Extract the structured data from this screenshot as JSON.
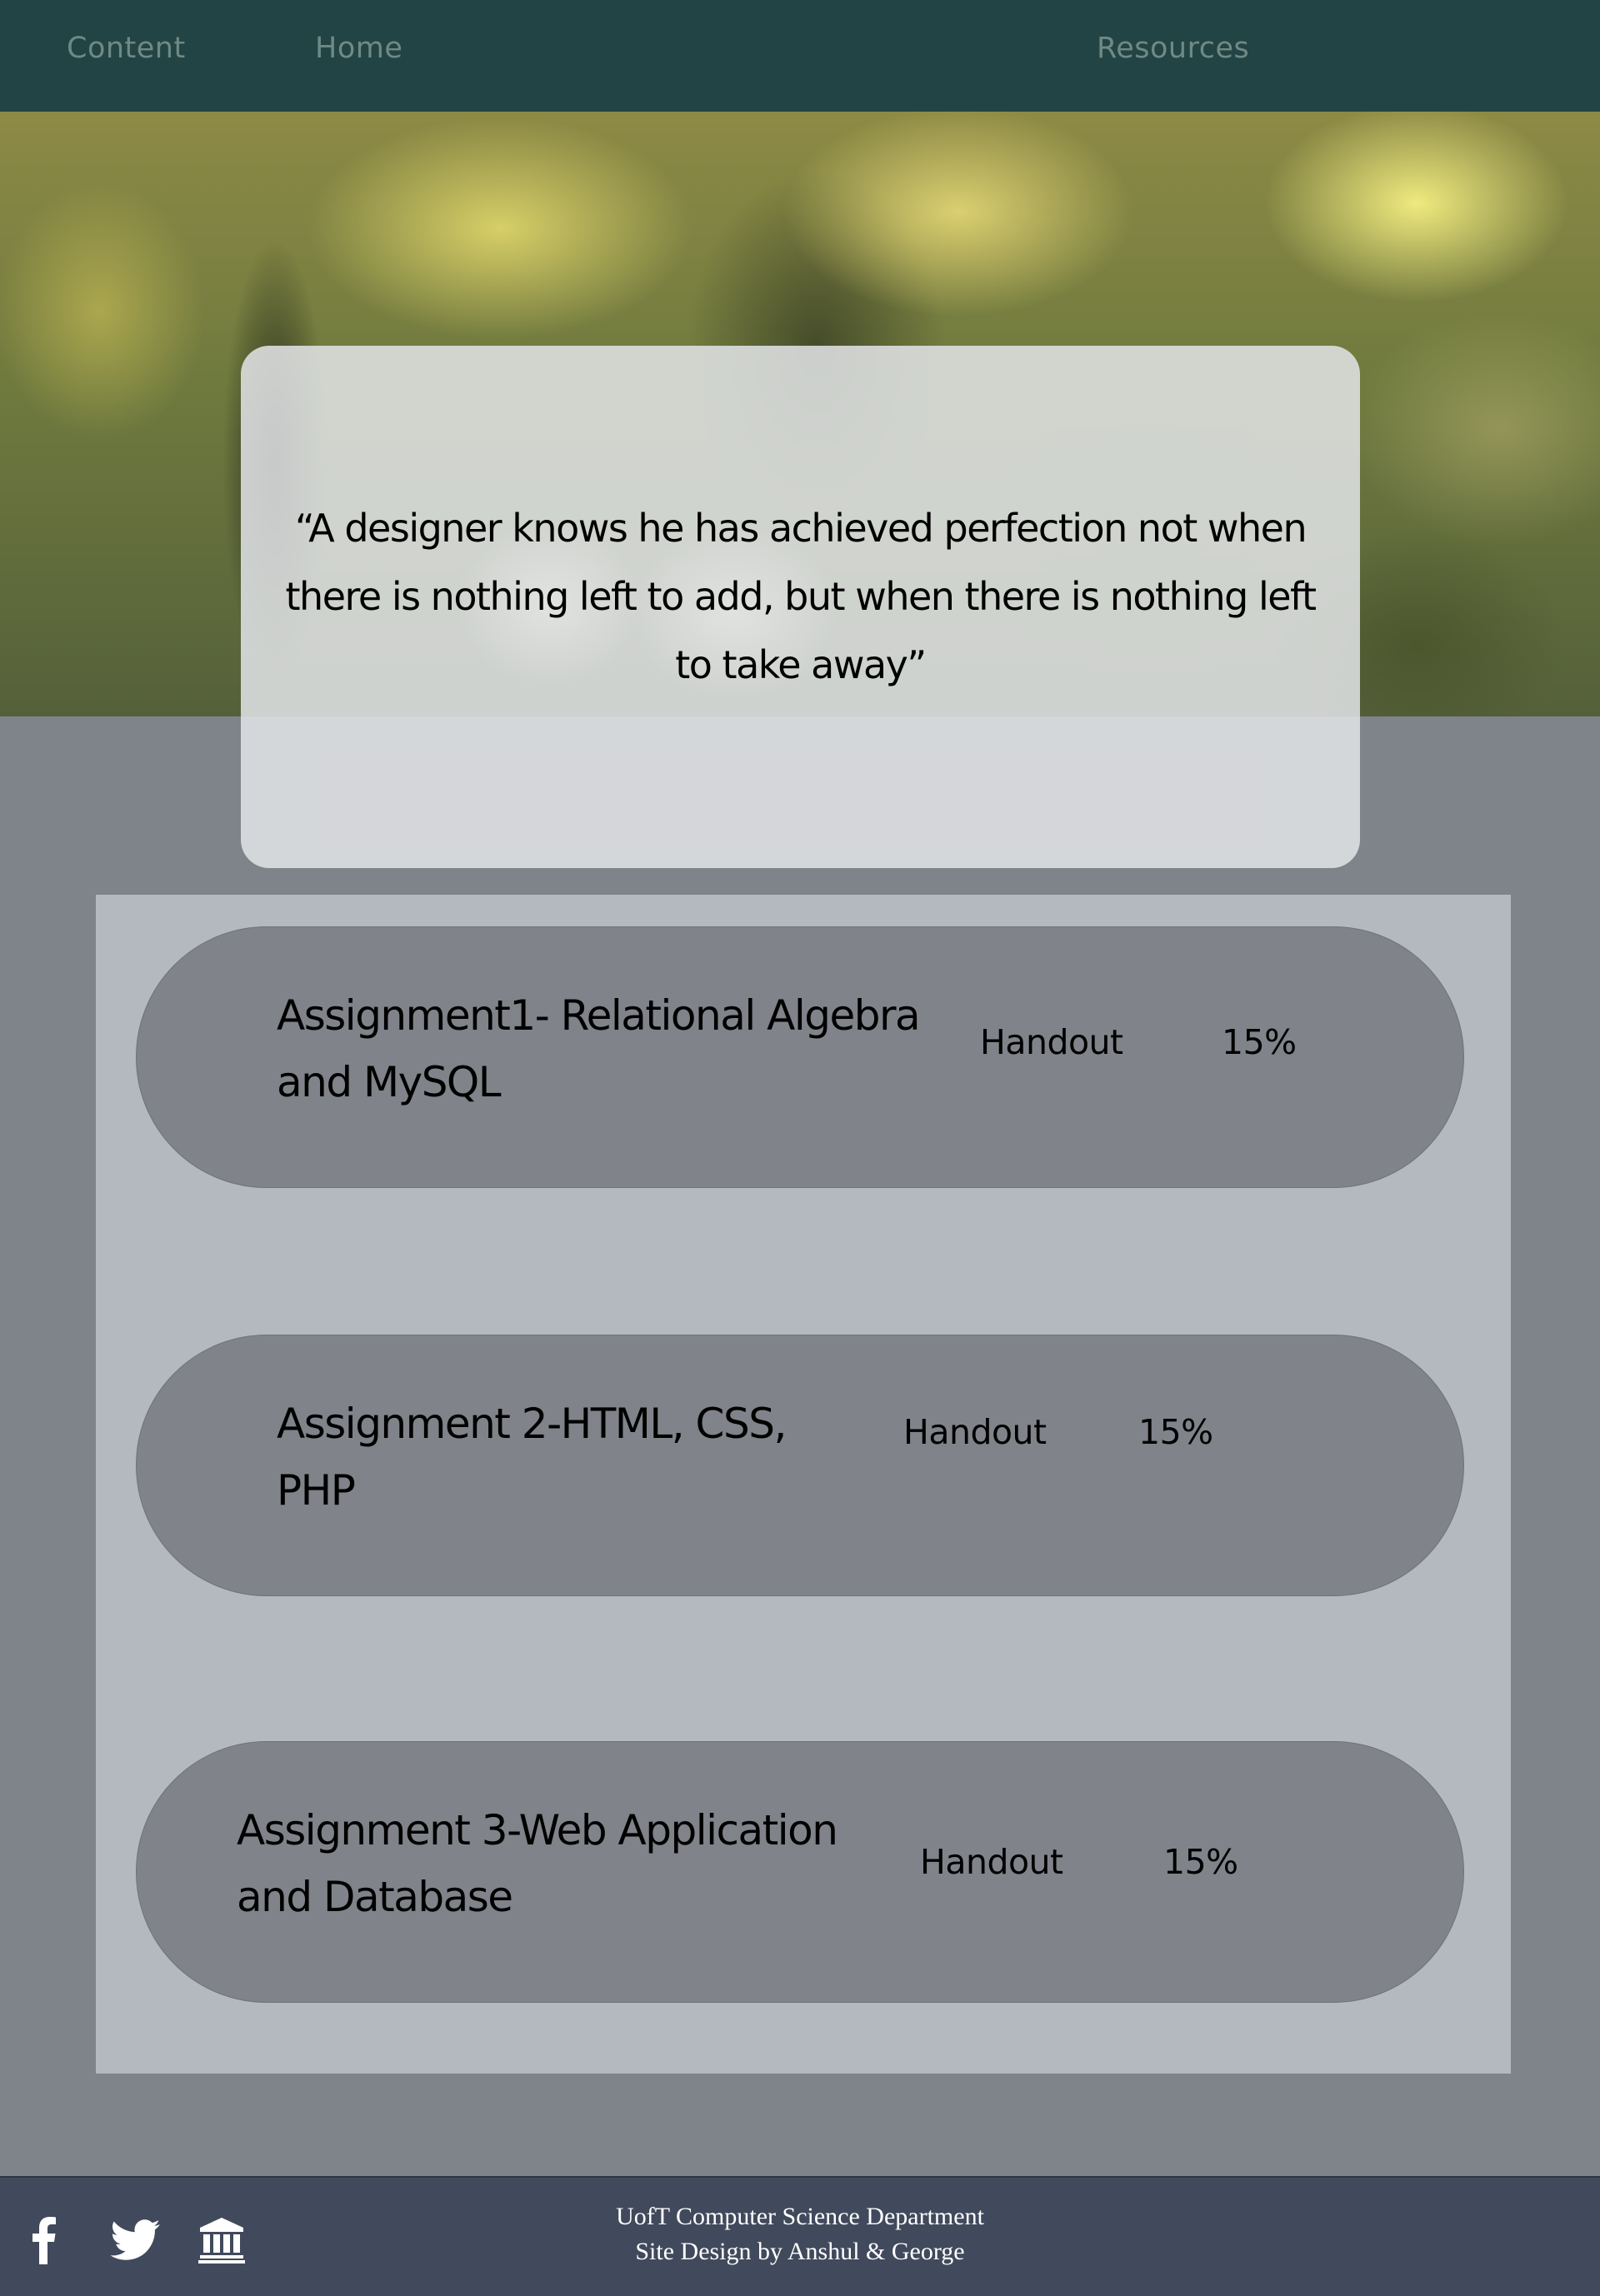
{
  "nav": {
    "items": [
      {
        "label": "Content"
      },
      {
        "label": "Home"
      },
      {
        "label": "Resources"
      }
    ]
  },
  "quote": {
    "text": "“A designer knows he has achieved perfection not when there is nothing left to add, but when there is nothing left to take away”"
  },
  "assignments": [
    {
      "title": "Assignment1- Relational Algebra and MySQL",
      "handout": "Handout",
      "weight": "15%"
    },
    {
      "title": "Assignment 2-HTML, CSS, PHP",
      "handout": "Handout",
      "weight": "15%"
    },
    {
      "title": "Assignment 3-Web Application and Database",
      "handout": "Handout",
      "weight": "15%"
    }
  ],
  "footer": {
    "line1": "UofT Computer Science Department",
    "line2": "Site Design by Anshul & George",
    "icons": [
      "facebook-icon",
      "twitter-icon",
      "university-icon"
    ]
  },
  "colors": {
    "nav_bg": "#234444",
    "nav_text": "#6f8a85",
    "page_bg": "#7f848b",
    "panel_bg": "#b3b9bf",
    "assignment_bg": "#808389",
    "footer_bg": "#414a5c"
  }
}
